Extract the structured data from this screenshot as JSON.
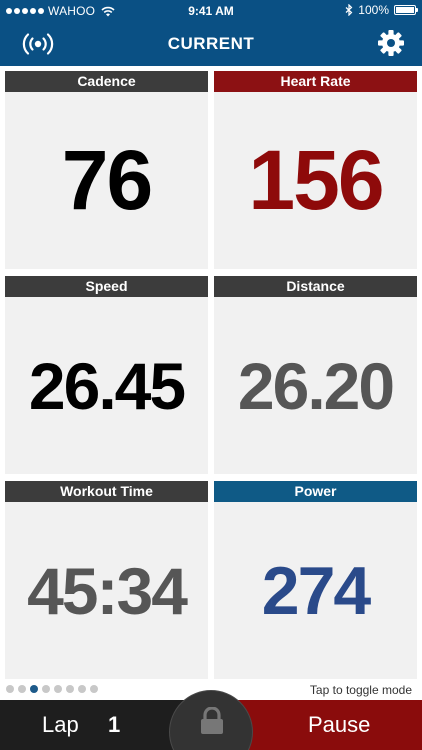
{
  "status_bar": {
    "carrier": "WAHOO",
    "time": "9:41 AM",
    "battery": "100%"
  },
  "nav": {
    "title": "CURRENT",
    "left_icon": "sensor-broadcast-icon",
    "right_icon": "gear-icon"
  },
  "tiles": [
    {
      "label": "Cadence",
      "value": "76",
      "header_color": "#3c3c3c",
      "value_color": "#000000"
    },
    {
      "label": "Heart Rate",
      "value": "156",
      "header_color": "#8c1113",
      "value_color": "#8e0a0a"
    },
    {
      "label": "Speed",
      "value": "26.45",
      "header_color": "#3c3c3c",
      "value_color": "#000000"
    },
    {
      "label": "Distance",
      "value": "26.20",
      "header_color": "#3c3c3c",
      "value_color": "#565656"
    },
    {
      "label": "Workout Time",
      "value": "45:34",
      "header_color": "#3c3c3c",
      "value_color": "#565656"
    },
    {
      "label": "Power",
      "value": "274",
      "header_color": "#0f5a86",
      "value_color": "#2a4a8a"
    }
  ],
  "pager": {
    "pages": 8,
    "current": 3
  },
  "toggle_hint": "Tap to toggle mode",
  "bottom_bar": {
    "lap_label": "Lap",
    "lap_number": "1",
    "pause_label": "Pause",
    "lock_icon": "lock-icon"
  },
  "colors": {
    "brand_blue": "#0a5084",
    "lap_bg": "#1e1e1e",
    "pause_bg": "#8a0c0c"
  }
}
